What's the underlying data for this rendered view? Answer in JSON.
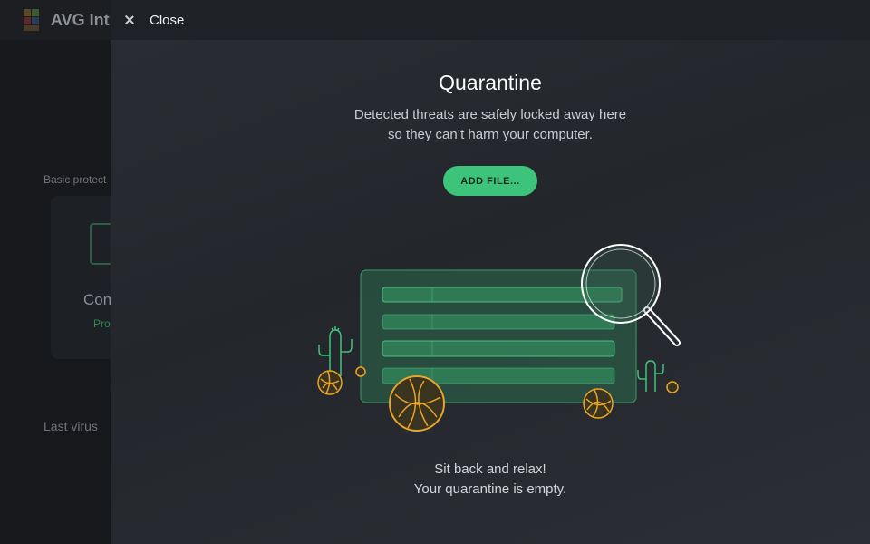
{
  "background_app": {
    "brand": "AVG Int",
    "section_label": "Basic protect",
    "card_title": "Con",
    "card_status": "Pro",
    "last_virus_label": "Last virus"
  },
  "header": {
    "close_label": "Close"
  },
  "main": {
    "title": "Quarantine",
    "subtitle_line1": "Detected threats are safely locked away here",
    "subtitle_line2": "so they can’t harm your computer.",
    "add_file_label": "ADD FILE...",
    "empty_line1": "Sit back and relax!",
    "empty_line2": "Your quarantine is empty."
  },
  "icons": {
    "close": "close-icon",
    "illustration": "empty-quarantine-illustration",
    "magnifier": "magnifier-icon",
    "cactus": "cactus-icon",
    "tumbleweed": "tumbleweed-icon"
  },
  "colors": {
    "accent": "#3ec47a",
    "panel_bg": "#2a2e34",
    "header_bg": "#1e2125",
    "tumbleweed": "#e8a527"
  }
}
